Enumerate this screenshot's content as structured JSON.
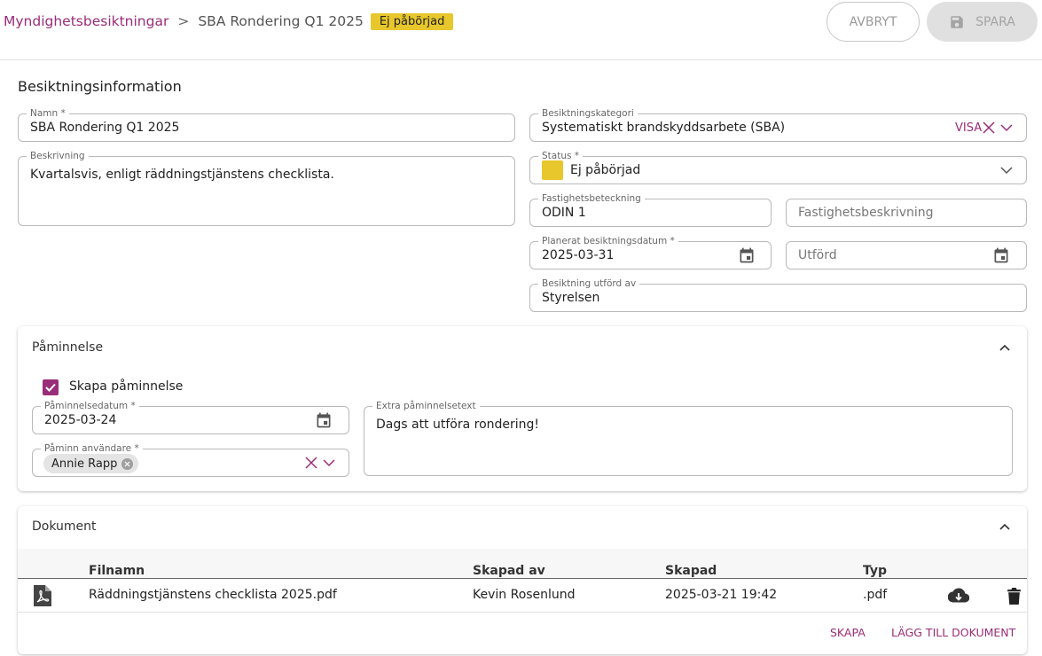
{
  "breadcrumb": {
    "parent": "Myndighetsbesiktningar",
    "separator": ">",
    "current": "SBA Rondering Q1 2025",
    "status_badge": "Ej påbörjad"
  },
  "actions": {
    "cancel": "AVBRYT",
    "save": "SPARA"
  },
  "info": {
    "title": "Besiktningsinformation",
    "name": {
      "label": "Namn *",
      "value": "SBA Rondering Q1 2025"
    },
    "description": {
      "label": "Beskrivning",
      "value": "Kvartalsvis, enligt räddningstjänstens checklista."
    },
    "category": {
      "label": "Besiktningskategori",
      "value": "Systematiskt brandskyddsarbete (SBA)",
      "show_label": "VISA"
    },
    "status": {
      "label": "Status *",
      "value": "Ej påbörjad",
      "color": "#e8c72c"
    },
    "property": {
      "label": "Fastighetsbeteckning",
      "value": "ODIN 1"
    },
    "property_desc": {
      "placeholder": "Fastighetsbeskrivning"
    },
    "planned_date": {
      "label": "Planerat besiktningsdatum *",
      "value": "2025-03-31"
    },
    "performed": {
      "placeholder": "Utförd"
    },
    "performed_by": {
      "label": "Besiktning utförd av",
      "value": "Styrelsen"
    }
  },
  "reminder": {
    "title": "Påminnelse",
    "checkbox_label": "Skapa påminnelse",
    "checked": true,
    "date": {
      "label": "Påminnelsedatum *",
      "value": "2025-03-24"
    },
    "users": {
      "label": "Påminn användare *",
      "chips": [
        "Annie Rapp"
      ]
    },
    "extra_text": {
      "label": "Extra påminnelsetext",
      "value": "Dags att utföra rondering!"
    }
  },
  "documents": {
    "title": "Dokument",
    "columns": [
      "Filnamn",
      "Skapad av",
      "Skapad",
      "Typ"
    ],
    "rows": [
      {
        "file": "Räddningstjänstens checklista 2025.pdf",
        "created_by": "Kevin Rosenlund",
        "created": "2025-03-21 19:42",
        "type": ".pdf"
      }
    ],
    "create": "SKAPA",
    "add": "LÄGG TILL DOKUMENT"
  },
  "colors": {
    "accent": "#9a2d78",
    "badge": "#e8c72c"
  }
}
